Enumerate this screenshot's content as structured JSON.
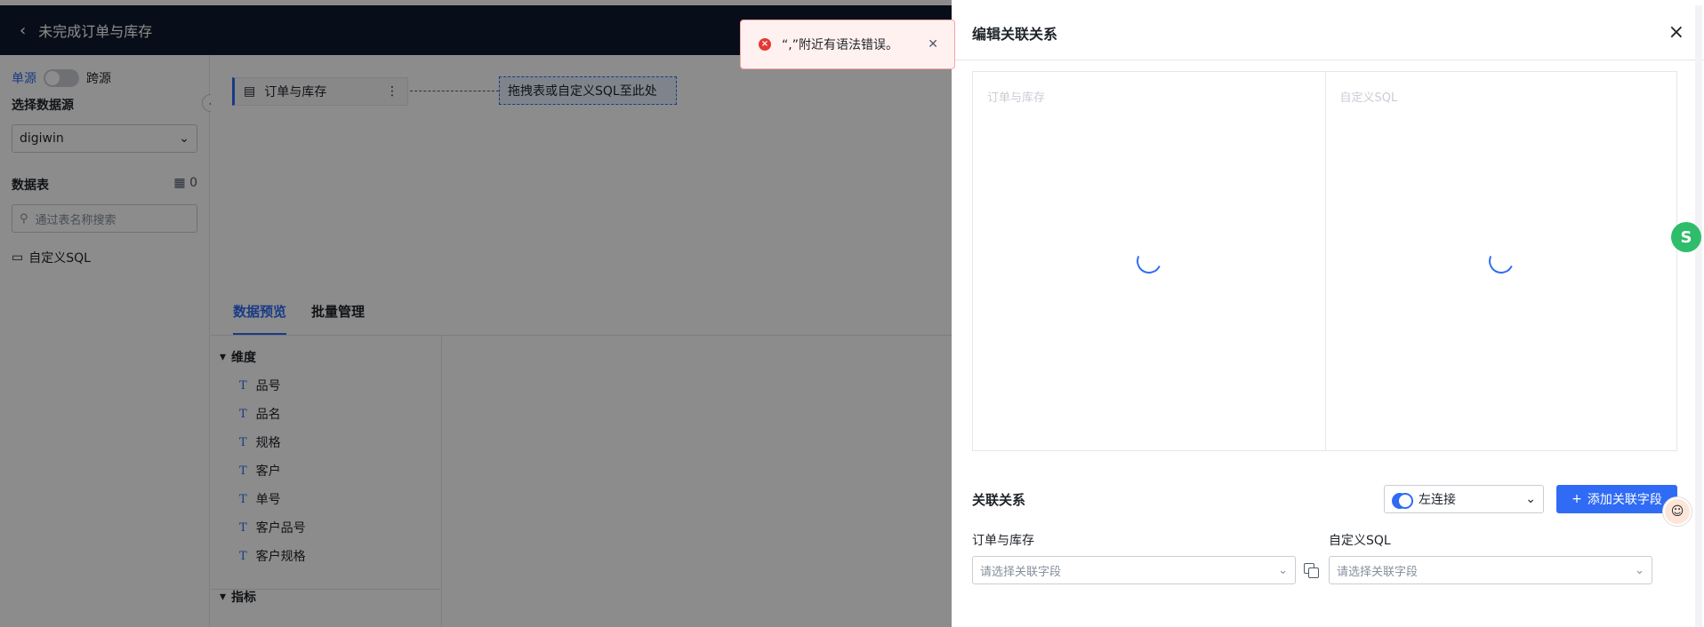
{
  "header": {
    "back_icon": "chevron-left-icon",
    "title": "未完成订单与库存"
  },
  "sidebar": {
    "mode_single": "单源",
    "mode_cross": "跨源",
    "datasource_label": "选择数据源",
    "datasource_value": "digiwin",
    "tables_label": "数据表",
    "tables_count": "0",
    "search_placeholder": "通过表名称搜索",
    "custom_sql": "自定义SQL"
  },
  "canvas": {
    "node_label": "订单与库存",
    "dropzone_text": "拖拽表或自定义SQL至此处"
  },
  "tabs": [
    "数据预览",
    "批量管理"
  ],
  "fields": {
    "dimension_group": "维度",
    "dimensions": [
      "品号",
      "品名",
      "规格",
      "客户",
      "单号",
      "客户品号",
      "客户规格"
    ],
    "measure_group": "指标",
    "type_marker": "T"
  },
  "toast": {
    "message": "“,”附近有语法错误。"
  },
  "drawer": {
    "title": "编辑关联关系",
    "left_panel": "订单与库存",
    "right_panel": "自定义SQL",
    "relation_title": "关联关系",
    "join_type": "左连接",
    "add_button": "添加关联字段",
    "left_col_label": "订单与库存",
    "right_col_label": "自定义SQL",
    "left_placeholder": "请选择关联字段",
    "right_placeholder": "请选择关联字段"
  },
  "colors": {
    "accent": "#2f6bf5",
    "topbar": "#0f1a2e",
    "error": "#e53935"
  }
}
